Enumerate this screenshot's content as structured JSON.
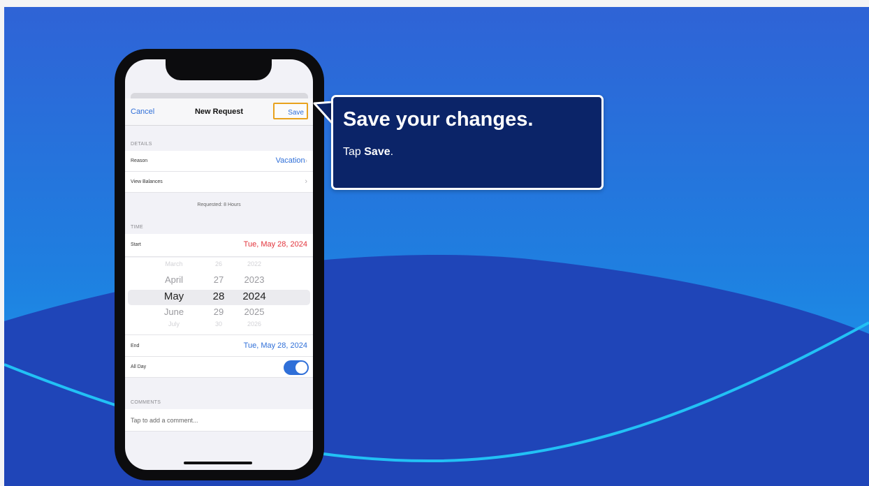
{
  "colors": {
    "background_top": "#2f63d6",
    "background_bottom": "#19a3f0",
    "wave": "#1f45b8",
    "wave_line": "#22c1f5",
    "phone_frame": "#0c0c0e",
    "ios_blue": "#2f6fd8",
    "ios_red": "#e2333b",
    "highlight": "#e8a21e",
    "callout_fill": "#0b2468",
    "callout_border": "#ffffff"
  },
  "nav": {
    "cancel": "Cancel",
    "title": "New Request",
    "save": "Save"
  },
  "details": {
    "section": "DETAILS",
    "reason_label": "Reason",
    "reason_value": "Vacation",
    "balances_label": "View Balances",
    "requested": "Requested: 8 Hours"
  },
  "time": {
    "section": "TIME",
    "start_label": "Start",
    "start_value": "Tue, May 28, 2024",
    "end_label": "End",
    "end_value": "Tue, May 28, 2024",
    "allday_label": "All Day",
    "allday_on": true
  },
  "picker": {
    "months": [
      "March",
      "April",
      "May",
      "June",
      "July"
    ],
    "days": [
      "26",
      "27",
      "28",
      "29",
      "30"
    ],
    "years": [
      "2022",
      "2023",
      "2024",
      "2025",
      "2026"
    ],
    "selected_index": 2
  },
  "comments": {
    "section": "COMMENTS",
    "placeholder": "Tap to add a comment..."
  },
  "callout": {
    "title": "Save your changes.",
    "body_prefix": "Tap ",
    "body_strong": "Save",
    "body_suffix": "."
  },
  "icons": {
    "chevron": "chevron-right-icon",
    "toggle": "toggle-switch"
  }
}
